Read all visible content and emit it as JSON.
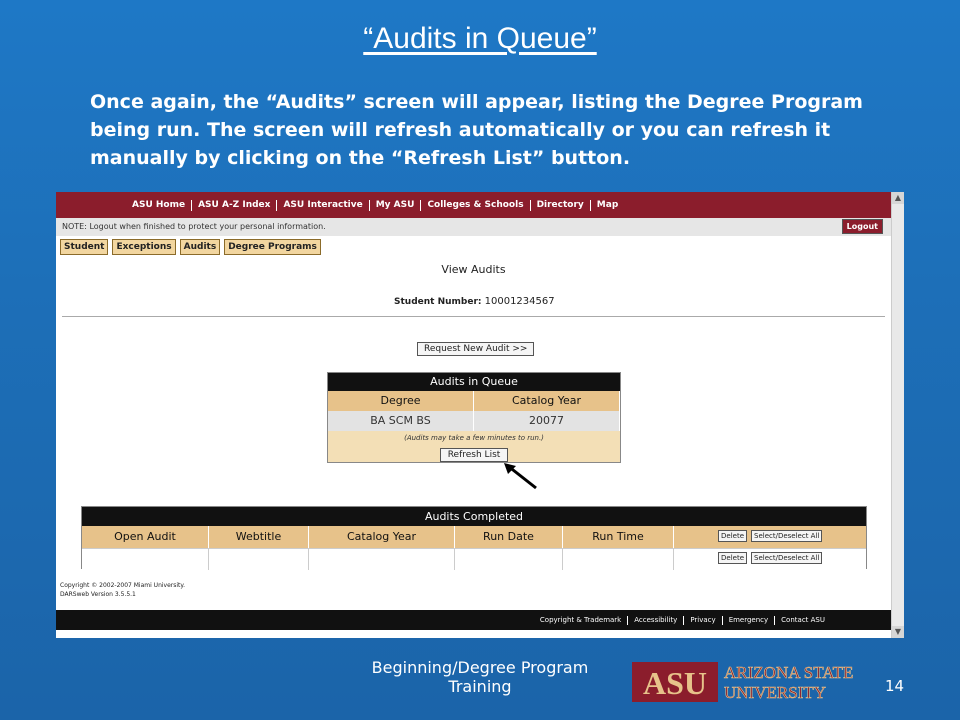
{
  "slide": {
    "title": "“Audits in Queue”",
    "body": "Once again, the “Audits” screen will appear, listing the Degree Program being run.  The screen will refresh automatically or you can refresh it manually by clicking on the “Refresh List” button.",
    "footer": "Beginning/Degree Program Training",
    "page_number": "14",
    "logo_text": "ASU ARIZONA STATE UNIVERSITY"
  },
  "browser": {
    "nav": [
      "ASU Home",
      "ASU A-Z Index",
      "ASU Interactive",
      "My ASU",
      "Colleges & Schools",
      "Directory",
      "Map"
    ],
    "note": "NOTE: Logout when finished to protect your personal information.",
    "logout_label": "Logout",
    "tabs": [
      "Student",
      "Exceptions",
      "Audits",
      "Degree Programs"
    ],
    "view_title": "View Audits",
    "student_label": "Student Number:",
    "student_number": "10001234567",
    "request_button": "Request New Audit >>",
    "queue": {
      "title": "Audits in Queue",
      "columns": [
        "Degree",
        "Catalog Year"
      ],
      "row": [
        "BA SCM BS",
        "20077"
      ],
      "hint": "(Audits may take a few minutes to run.)",
      "refresh_button": "Refresh List"
    },
    "completed": {
      "title": "Audits Completed",
      "columns": [
        "Open Audit",
        "Webtitle",
        "Catalog Year",
        "Run Date",
        "Run Time"
      ],
      "delete_label": "Delete",
      "select_label": "Select/Deselect All"
    },
    "copyright_line1": "Copyright © 2002-2007 Miami University.",
    "copyright_line2": "DARSweb Version 3.5.5.1",
    "footer_links": [
      "Copyright & Trademark",
      "Accessibility",
      "Privacy",
      "Emergency",
      "Contact ASU"
    ]
  },
  "colors": {
    "asu_maroon": "#8b1d2c",
    "asu_gold": "#e7c28a",
    "slide_blue": "#1d6fb8"
  }
}
